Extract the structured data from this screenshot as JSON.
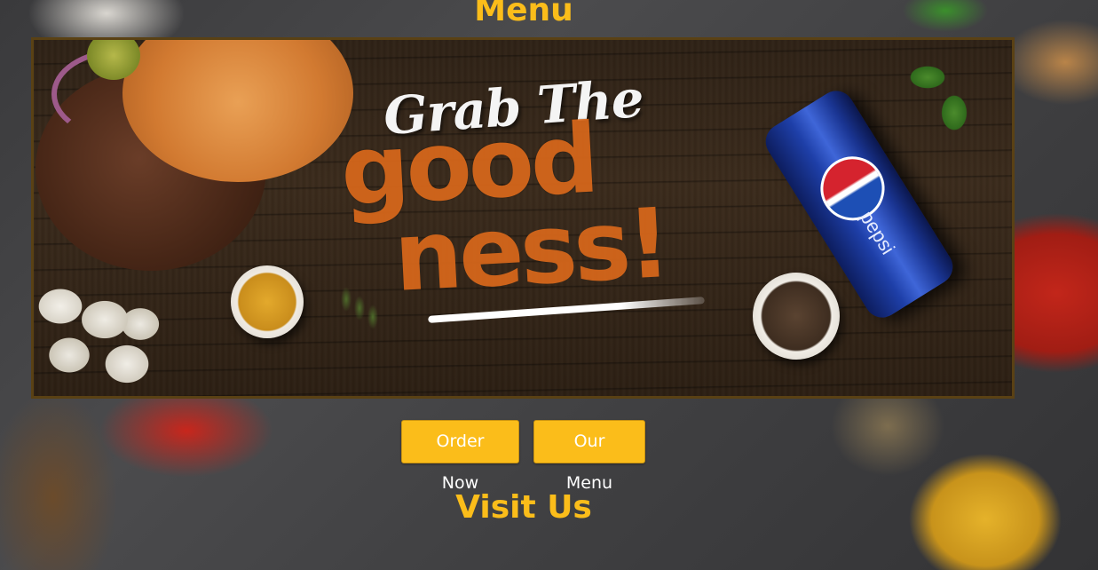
{
  "header": {
    "title": "Menu"
  },
  "banner": {
    "alt": "Grab The goodness! banner with burger and Pepsi can",
    "script_text": "Grab The",
    "big_text_line1": "good",
    "big_text_line2": "ness!",
    "can_brand": "pepsi"
  },
  "actions": {
    "order_label": "Order Now",
    "menu_label": "Our Menu"
  },
  "visit": {
    "title": "Visit Us"
  },
  "colors": {
    "accent": "#fbbd1a",
    "button_text": "#ffffff",
    "banner_border": "#5a4114"
  }
}
